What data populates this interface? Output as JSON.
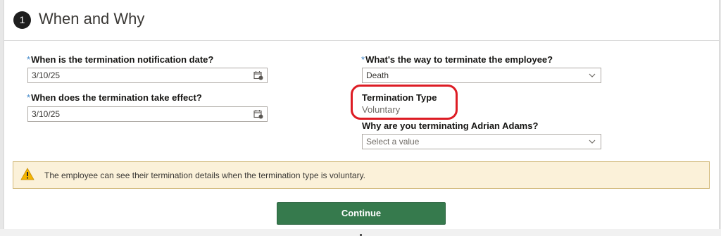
{
  "section": {
    "step_number": "1",
    "title": "When and Why"
  },
  "fields": {
    "notification_date": {
      "required_marker": "*",
      "label": "When is the termination notification date?",
      "value": "3/10/25",
      "icon": "calendar-icon"
    },
    "effective_date": {
      "required_marker": "*",
      "label": "When does the termination take effect?",
      "value": "3/10/25",
      "icon": "calendar-icon"
    },
    "termination_way": {
      "required_marker": "*",
      "label": "What's the way to terminate the employee?",
      "value": "Death",
      "icon": "chevron-down-icon"
    },
    "termination_type": {
      "label": "Termination Type",
      "value": "Voluntary"
    },
    "reason": {
      "label": "Why are you terminating Adrian Adams?",
      "placeholder": "Select a value",
      "icon": "chevron-down-icon"
    }
  },
  "warning": {
    "icon": "warning-icon",
    "text": "The employee can see their termination details when the termination type is voluntary."
  },
  "actions": {
    "continue_label": "Continue"
  },
  "colors": {
    "accent_green": "#367a4d",
    "highlight_red": "#dd1c24",
    "warning_bg": "#fbf1d9",
    "required_blue": "#3e86c8"
  }
}
